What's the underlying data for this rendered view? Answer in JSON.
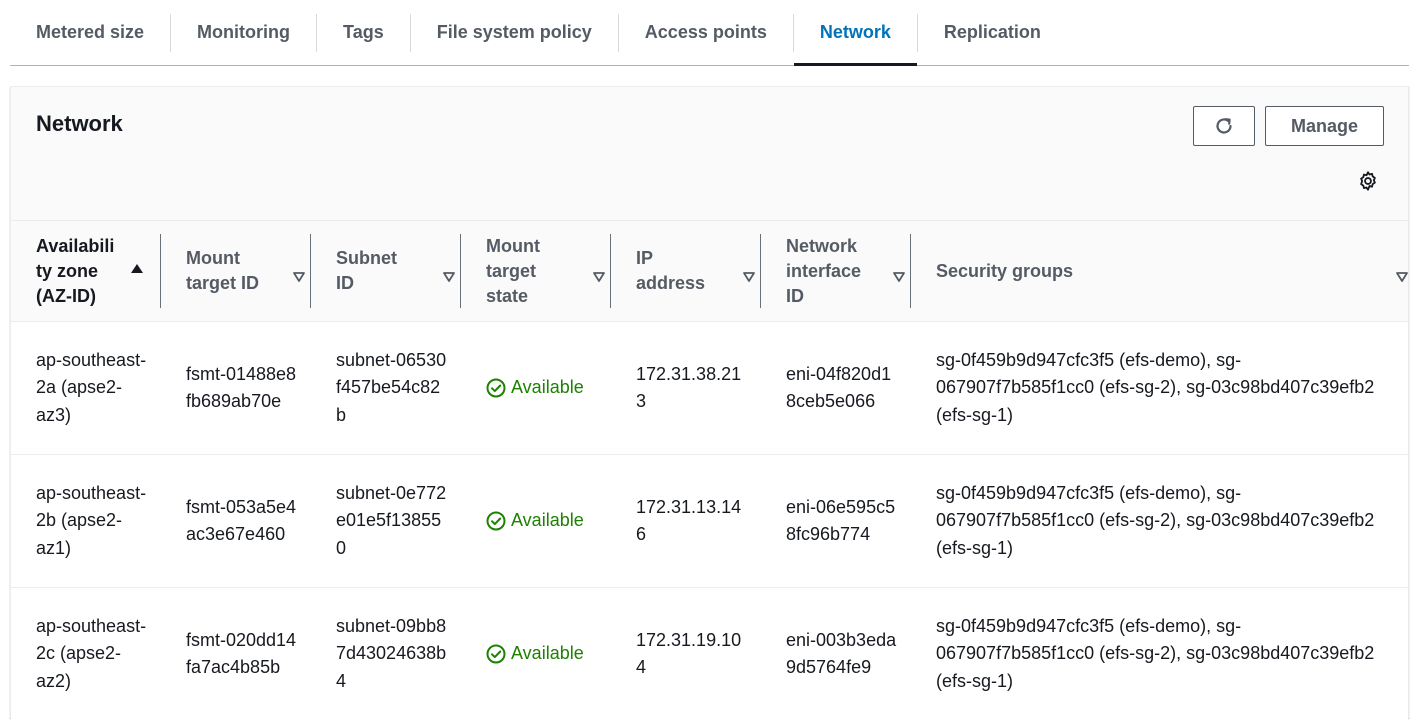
{
  "tabs": [
    {
      "label": "Metered size",
      "active": false
    },
    {
      "label": "Monitoring",
      "active": false
    },
    {
      "label": "Tags",
      "active": false
    },
    {
      "label": "File system policy",
      "active": false
    },
    {
      "label": "Access points",
      "active": false
    },
    {
      "label": "Network",
      "active": true
    },
    {
      "label": "Replication",
      "active": false
    }
  ],
  "panel": {
    "title": "Network",
    "refresh_icon": "refresh-icon",
    "manage_label": "Manage",
    "settings_icon": "gear-icon"
  },
  "table": {
    "columns": [
      {
        "label": "Availability zone (AZ-ID)",
        "sort": "ascending"
      },
      {
        "label": "Mount target ID",
        "sort": "none"
      },
      {
        "label": "Subnet ID",
        "sort": "none"
      },
      {
        "label": "Mount target state",
        "sort": "none"
      },
      {
        "label": "IP address",
        "sort": "none"
      },
      {
        "label": "Network interface ID",
        "sort": "none"
      },
      {
        "label": "Security groups",
        "sort": "none"
      }
    ],
    "rows": [
      {
        "az": "ap-southeast-2a (apse2-az3)",
        "mount_target_id": "fsmt-01488e8fb689ab70e",
        "subnet_id": "subnet-06530f457be54c82b",
        "state": "Available",
        "ip": "172.31.38.213",
        "eni": "eni-04f820d18ceb5e066",
        "security_groups": "sg-0f459b9d947cfc3f5 (efs-demo), sg-067907f7b585f1cc0 (efs-sg-2), sg-03c98bd407c39efb2 (efs-sg-1)"
      },
      {
        "az": "ap-southeast-2b (apse2-az1)",
        "mount_target_id": "fsmt-053a5e4ac3e67e460",
        "subnet_id": "subnet-0e772e01e5f138550",
        "state": "Available",
        "ip": "172.31.13.146",
        "eni": "eni-06e595c58fc96b774",
        "security_groups": "sg-0f459b9d947cfc3f5 (efs-demo), sg-067907f7b585f1cc0 (efs-sg-2), sg-03c98bd407c39efb2 (efs-sg-1)"
      },
      {
        "az": "ap-southeast-2c (apse2-az2)",
        "mount_target_id": "fsmt-020dd14fa7ac4b85b",
        "subnet_id": "subnet-09bb87d43024638b4",
        "state": "Available",
        "ip": "172.31.19.104",
        "eni": "eni-003b3eda9d5764fe9",
        "security_groups": "sg-0f459b9d947cfc3f5 (efs-demo), sg-067907f7b585f1cc0 (efs-sg-2), sg-03c98bd407c39efb2 (efs-sg-1)"
      }
    ]
  },
  "colors": {
    "accent": "#0073bb",
    "success": "#1d8102",
    "text": "#16191f",
    "muted": "#545b64"
  }
}
